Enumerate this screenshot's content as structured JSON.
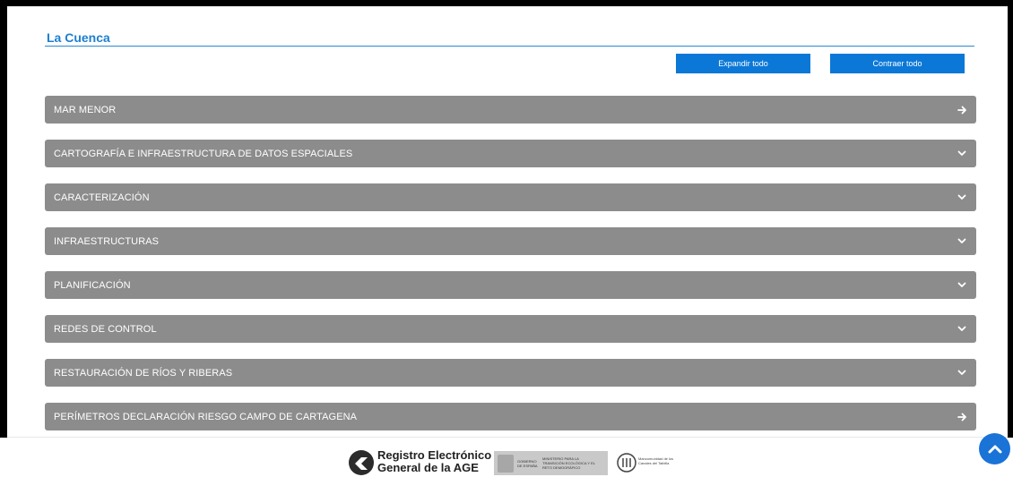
{
  "section": {
    "title": "La Cuenca"
  },
  "toolbar": {
    "expand_label": "Expandir todo",
    "collapse_label": "Contraer todo"
  },
  "accordion": [
    {
      "label": "MAR MENOR",
      "icon": "arrow-right-icon"
    },
    {
      "label": "CARTOGRAFÍA E INFRAESTRUCTURA DE DATOS ESPACIALES",
      "icon": "chevron-down-icon"
    },
    {
      "label": "CARACTERIZACIÓN",
      "icon": "chevron-down-icon"
    },
    {
      "label": "INFRAESTRUCTURAS",
      "icon": "chevron-down-icon"
    },
    {
      "label": "PLANIFICACIÓN",
      "icon": "chevron-down-icon"
    },
    {
      "label": "REDES DE CONTROL",
      "icon": "chevron-down-icon"
    },
    {
      "label": "RESTAURACIÓN DE RÍOS Y RIBERAS",
      "icon": "chevron-down-icon"
    },
    {
      "label": "PERÍMETROS DECLARACIÓN RIESGO CAMPO DE CARTAGENA",
      "icon": "arrow-right-icon"
    }
  ],
  "footer": {
    "age_line1": "Registro Electrónico",
    "age_line2": "General de la AGE",
    "gob_line1": "GOBIERNO DE ESPAÑA",
    "gob_line2": "MINISTERIO PARA LA TRANSICIÓN ECOLÓGICA Y EL RETO DEMOGRÁFICO",
    "mct_text": "Mancomunidad de los Canales del Taibilla"
  },
  "colors": {
    "accent": "#0b78d7",
    "accordion_bg": "#8c8c8c",
    "title": "#1e7fcf"
  }
}
